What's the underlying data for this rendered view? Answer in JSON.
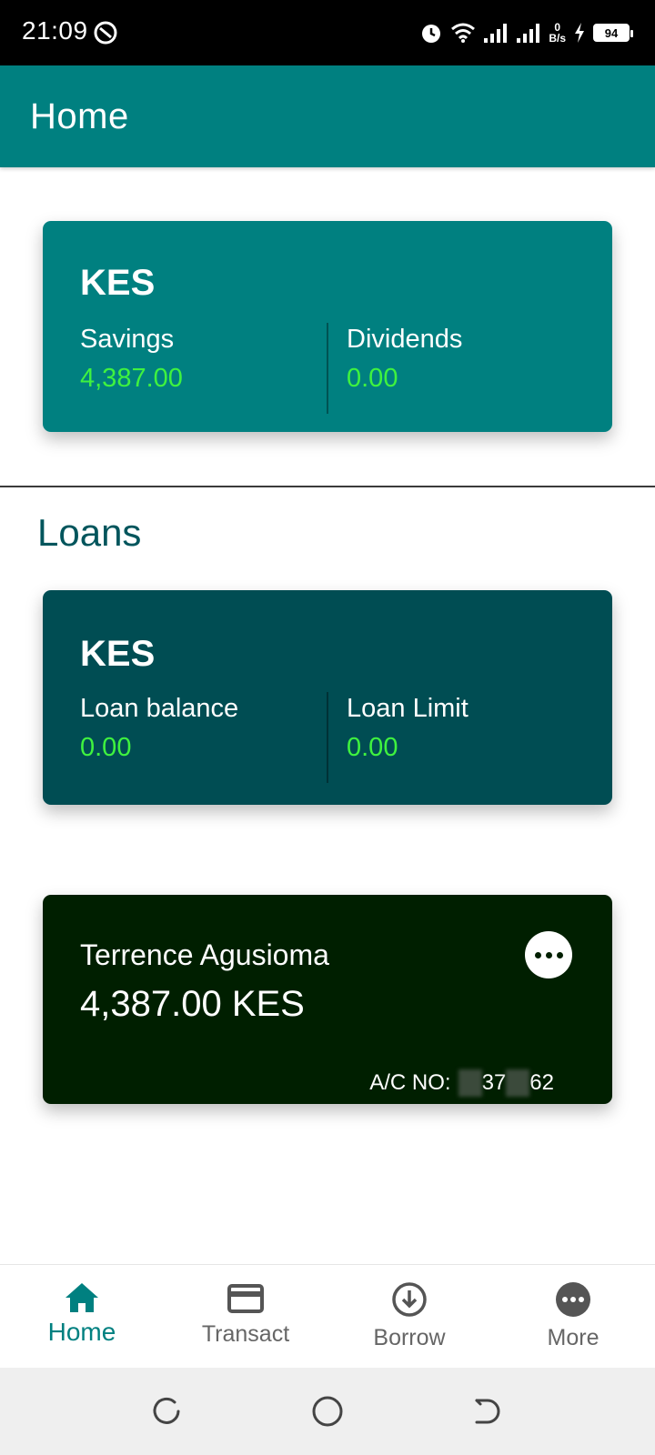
{
  "status_bar": {
    "time": "21:09",
    "network_speed_value": "0",
    "network_speed_unit": "B/s",
    "battery": "94",
    "icons": [
      "alarm-icon",
      "wifi-icon",
      "signal-icon",
      "signal-icon",
      "charging-icon",
      "battery-icon"
    ]
  },
  "app_bar": {
    "title": "Home"
  },
  "savings_card": {
    "currency": "KES",
    "left_label": "Savings",
    "left_value": "4,387.00",
    "right_label": "Dividends",
    "right_value": "0.00",
    "background": "#008080"
  },
  "loans_section": {
    "title": "Loans"
  },
  "loans_card": {
    "currency": "KES",
    "left_label": "Loan balance",
    "left_value": "0.00",
    "right_label": "Loan Limit",
    "right_value": "0.00",
    "background": "#004d53"
  },
  "account_card": {
    "name": "Terrence Agusioma",
    "balance": "4,387.00 KES",
    "ac_label": "A/C NO:",
    "ac_part1": "37",
    "ac_part2": "62",
    "background": "#001f00"
  },
  "bottom_nav": {
    "items": [
      {
        "label": "Home",
        "icon": "home-icon",
        "active": true
      },
      {
        "label": "Transact",
        "icon": "card-icon",
        "active": false
      },
      {
        "label": "Borrow",
        "icon": "download-circle-icon",
        "active": false
      },
      {
        "label": "More",
        "icon": "more-icon",
        "active": false
      }
    ]
  },
  "colors": {
    "accent": "#008080",
    "value_green": "#3ff23f",
    "section_title": "#00555c"
  }
}
